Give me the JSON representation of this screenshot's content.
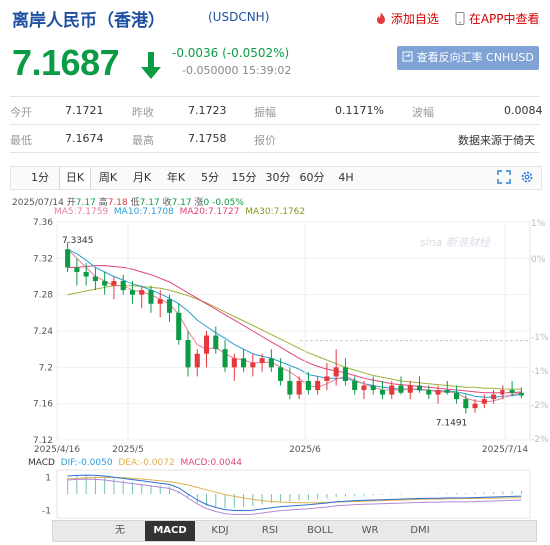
{
  "header": {
    "title": "离岸人民币（香港）",
    "code": "(USDCNH)",
    "add_watchlist": "添加自选",
    "app_view": "在APP中查看"
  },
  "quote": {
    "price": "7.1687",
    "change": "-0.0036 (-0.0502%)",
    "sub_change": "-0.050000",
    "time": "15:39:02",
    "reverse_button": "查看反向汇率 CNHUSD",
    "direction_color": "#0c9b45"
  },
  "stats": {
    "open_label": "今开",
    "open": "7.1721",
    "prev_close_label": "昨收",
    "prev_close": "7.1723",
    "amplitude_label": "振幅",
    "amplitude": "0.1171%",
    "wave_label": "波幅",
    "wave": "0.0084",
    "low_label": "最低",
    "low": "7.1674",
    "high_label": "最高",
    "high": "7.1758",
    "quote_label": "报价",
    "source": "数据来源于倚天"
  },
  "tabs": [
    "1分",
    "日K",
    "周K",
    "月K",
    "年K",
    "5分",
    "15分",
    "30分",
    "60分",
    "4H"
  ],
  "active_tab": "日K",
  "info": {
    "date": "2025/07/14",
    "open_label": "开",
    "open": "7.17",
    "high_label": "高",
    "high": "7.18",
    "low_label": "低",
    "low": "7.17",
    "close_label": "收",
    "close": "7.17",
    "change_label": "涨",
    "change": "0",
    "pct": "-0.05%",
    "ma5_label": "MA5:",
    "ma5": "7.1759",
    "ma10_label": "MA10:",
    "ma10": "7.1708",
    "ma20_label": "MA20:",
    "ma20": "7.1727",
    "ma30_label": "MA30:",
    "ma30": "7.1762"
  },
  "macd_info": {
    "label": "MACD",
    "dif_label": "DIF:",
    "dif": "-0.0050",
    "dea_label": "DEA:",
    "dea": "-0.0072",
    "macd_label": "MACD:",
    "macd": "0.0044"
  },
  "indicator_tabs": [
    "无",
    "MACD",
    "KDJ",
    "RSI",
    "BOLL",
    "WR",
    "DMI"
  ],
  "active_indicator": "MACD",
  "watermark": "sina 新浪财经",
  "colors": {
    "up": "#e4393c",
    "down": "#0c9b45",
    "ma5": "#e87f9e",
    "ma10": "#2a9fd6",
    "ma20": "#e0457b",
    "ma30": "#a2b03b"
  },
  "chart_data": {
    "type": "candlestick",
    "ylim": [
      7.12,
      7.36
    ],
    "y_ticks": [
      "7.36",
      "7.32",
      "7.28",
      "7.24",
      "7.2",
      "7.16",
      "7.12"
    ],
    "pct_ticks": [
      "1%",
      "0%",
      "-1%",
      "-1%",
      "-2%",
      "-2%"
    ],
    "x_labels": [
      "2025/4/16",
      "2025/5",
      "2025/6",
      "2025/7/14"
    ],
    "annotations": {
      "max": "7.3345",
      "min": "7.1491"
    },
    "macd_ticks": [
      "1",
      "-1"
    ],
    "candles": [
      [
        7.33,
        7.338,
        7.305,
        7.31
      ],
      [
        7.31,
        7.32,
        7.29,
        7.305
      ],
      [
        7.305,
        7.315,
        7.29,
        7.3
      ],
      [
        7.3,
        7.31,
        7.285,
        7.295
      ],
      [
        7.295,
        7.305,
        7.28,
        7.29
      ],
      [
        7.29,
        7.3,
        7.275,
        7.295
      ],
      [
        7.295,
        7.302,
        7.28,
        7.285
      ],
      [
        7.285,
        7.295,
        7.27,
        7.28
      ],
      [
        7.28,
        7.29,
        7.265,
        7.285
      ],
      [
        7.285,
        7.29,
        7.26,
        7.27
      ],
      [
        7.27,
        7.285,
        7.255,
        7.275
      ],
      [
        7.275,
        7.28,
        7.25,
        7.26
      ],
      [
        7.26,
        7.27,
        7.225,
        7.23
      ],
      [
        7.23,
        7.24,
        7.19,
        7.2
      ],
      [
        7.2,
        7.22,
        7.19,
        7.215
      ],
      [
        7.215,
        7.24,
        7.2,
        7.235
      ],
      [
        7.235,
        7.245,
        7.215,
        7.22
      ],
      [
        7.22,
        7.23,
        7.195,
        7.2
      ],
      [
        7.2,
        7.215,
        7.185,
        7.21
      ],
      [
        7.21,
        7.22,
        7.195,
        7.2
      ],
      [
        7.2,
        7.215,
        7.19,
        7.205
      ],
      [
        7.205,
        7.215,
        7.195,
        7.21
      ],
      [
        7.21,
        7.22,
        7.195,
        7.2
      ],
      [
        7.2,
        7.21,
        7.18,
        7.185
      ],
      [
        7.185,
        7.2,
        7.165,
        7.17
      ],
      [
        7.17,
        7.19,
        7.165,
        7.185
      ],
      [
        7.185,
        7.195,
        7.17,
        7.175
      ],
      [
        7.175,
        7.19,
        7.17,
        7.185
      ],
      [
        7.185,
        7.205,
        7.175,
        7.19
      ],
      [
        7.19,
        7.22,
        7.18,
        7.2
      ],
      [
        7.2,
        7.21,
        7.18,
        7.185
      ],
      [
        7.185,
        7.19,
        7.17,
        7.175
      ],
      [
        7.175,
        7.185,
        7.165,
        7.18
      ],
      [
        7.18,
        7.19,
        7.17,
        7.175
      ],
      [
        7.175,
        7.185,
        7.165,
        7.17
      ],
      [
        7.17,
        7.185,
        7.165,
        7.18
      ],
      [
        7.18,
        7.19,
        7.17,
        7.172
      ],
      [
        7.172,
        7.185,
        7.165,
        7.18
      ],
      [
        7.18,
        7.19,
        7.172,
        7.175
      ],
      [
        7.175,
        7.18,
        7.165,
        7.17
      ],
      [
        7.17,
        7.18,
        7.16,
        7.175
      ],
      [
        7.175,
        7.185,
        7.17,
        7.172
      ],
      [
        7.172,
        7.18,
        7.16,
        7.165
      ],
      [
        7.165,
        7.17,
        7.149,
        7.155
      ],
      [
        7.155,
        7.165,
        7.15,
        7.16
      ],
      [
        7.16,
        7.17,
        7.155,
        7.165
      ],
      [
        7.165,
        7.175,
        7.16,
        7.17
      ],
      [
        7.17,
        7.18,
        7.165,
        7.175
      ],
      [
        7.175,
        7.185,
        7.168,
        7.172
      ],
      [
        7.172,
        7.178,
        7.166,
        7.169
      ]
    ],
    "ma5": [
      7.33,
      7.32,
      7.31,
      7.3,
      7.295,
      7.29,
      7.29,
      7.285,
      7.283,
      7.28,
      7.275,
      7.27,
      7.258,
      7.24,
      7.225,
      7.22,
      7.222,
      7.215,
      7.21,
      7.208,
      7.205,
      7.205,
      7.206,
      7.2,
      7.195,
      7.188,
      7.18,
      7.178,
      7.182,
      7.187,
      7.19,
      7.186,
      7.182,
      7.178,
      7.175,
      7.175,
      7.175,
      7.176,
      7.176,
      7.175,
      7.173,
      7.173,
      7.172,
      7.166,
      7.163,
      7.162,
      7.163,
      7.166,
      7.17,
      7.172
    ],
    "ma10": [
      7.33,
      7.325,
      7.318,
      7.31,
      7.305,
      7.3,
      7.296,
      7.292,
      7.289,
      7.285,
      7.281,
      7.276,
      7.27,
      7.262,
      7.252,
      7.245,
      7.238,
      7.232,
      7.225,
      7.22,
      7.215,
      7.212,
      7.21,
      7.206,
      7.202,
      7.198,
      7.192,
      7.19,
      7.188,
      7.188,
      7.188,
      7.185,
      7.182,
      7.18,
      7.178,
      7.177,
      7.176,
      7.176,
      7.175,
      7.175,
      7.174,
      7.174,
      7.173,
      7.171,
      7.168,
      7.167,
      7.167,
      7.168,
      7.169,
      7.17
    ],
    "ma20": [
      7.31,
      7.31,
      7.311,
      7.312,
      7.312,
      7.311,
      7.31,
      7.308,
      7.305,
      7.302,
      7.298,
      7.294,
      7.288,
      7.282,
      7.276,
      7.27,
      7.264,
      7.258,
      7.252,
      7.246,
      7.24,
      7.234,
      7.228,
      7.222,
      7.216,
      7.21,
      7.205,
      7.201,
      7.198,
      7.196,
      7.194,
      7.191,
      7.188,
      7.186,
      7.184,
      7.182,
      7.181,
      7.18,
      7.179,
      7.178,
      7.177,
      7.176,
      7.175,
      7.174,
      7.173,
      7.172,
      7.172,
      7.172,
      7.172,
      7.173
    ],
    "ma30": [
      7.28,
      7.282,
      7.284,
      7.286,
      7.288,
      7.29,
      7.29,
      7.29,
      7.289,
      7.288,
      7.287,
      7.285,
      7.282,
      7.279,
      7.275,
      7.271,
      7.266,
      7.261,
      7.256,
      7.251,
      7.246,
      7.241,
      7.236,
      7.231,
      7.226,
      7.221,
      7.216,
      7.212,
      7.208,
      7.204,
      7.2,
      7.197,
      7.194,
      7.191,
      7.189,
      7.187,
      7.185,
      7.184,
      7.183,
      7.182,
      7.181,
      7.18,
      7.179,
      7.178,
      7.178,
      7.177,
      7.177,
      7.176,
      7.176,
      7.176
    ],
    "macd_hist": [
      0.55,
      0.6,
      0.62,
      0.58,
      0.55,
      0.5,
      0.45,
      0.4,
      0.35,
      0.3,
      0.28,
      0.25,
      0.1,
      -0.1,
      -0.3,
      -0.4,
      -0.45,
      -0.48,
      -0.45,
      -0.42,
      -0.4,
      -0.35,
      -0.3,
      -0.28,
      -0.25,
      -0.22,
      -0.2,
      -0.18,
      -0.15,
      -0.1,
      -0.08,
      -0.06,
      -0.05,
      -0.04,
      -0.03,
      -0.02,
      -0.02,
      -0.01,
      0.0,
      0.01,
      0.02,
      0.02,
      0.03,
      0.03,
      0.04,
      0.05,
      0.06,
      0.08,
      0.09,
      0.1
    ],
    "dif": [
      0.6,
      0.62,
      0.63,
      0.62,
      0.6,
      0.56,
      0.52,
      0.48,
      0.44,
      0.4,
      0.36,
      0.32,
      0.2,
      0.0,
      -0.2,
      -0.35,
      -0.45,
      -0.52,
      -0.55,
      -0.55,
      -0.54,
      -0.5,
      -0.46,
      -0.42,
      -0.4,
      -0.38,
      -0.36,
      -0.33,
      -0.3,
      -0.26,
      -0.24,
      -0.22,
      -0.21,
      -0.2,
      -0.19,
      -0.18,
      -0.17,
      -0.16,
      -0.15,
      -0.14,
      -0.14,
      -0.13,
      -0.13,
      -0.13,
      -0.12,
      -0.11,
      -0.1,
      -0.09,
      -0.08,
      -0.07
    ],
    "dea": [
      0.5,
      0.52,
      0.54,
      0.55,
      0.56,
      0.55,
      0.54,
      0.52,
      0.5,
      0.47,
      0.44,
      0.41,
      0.36,
      0.3,
      0.22,
      0.14,
      0.06,
      -0.02,
      -0.08,
      -0.13,
      -0.18,
      -0.22,
      -0.25,
      -0.27,
      -0.28,
      -0.29,
      -0.29,
      -0.29,
      -0.28,
      -0.27,
      -0.26,
      -0.25,
      -0.24,
      -0.23,
      -0.22,
      -0.21,
      -0.2,
      -0.19,
      -0.18,
      -0.17,
      -0.17,
      -0.16,
      -0.16,
      -0.15,
      -0.15,
      -0.14,
      -0.14,
      -0.13,
      -0.13,
      -0.12
    ]
  }
}
